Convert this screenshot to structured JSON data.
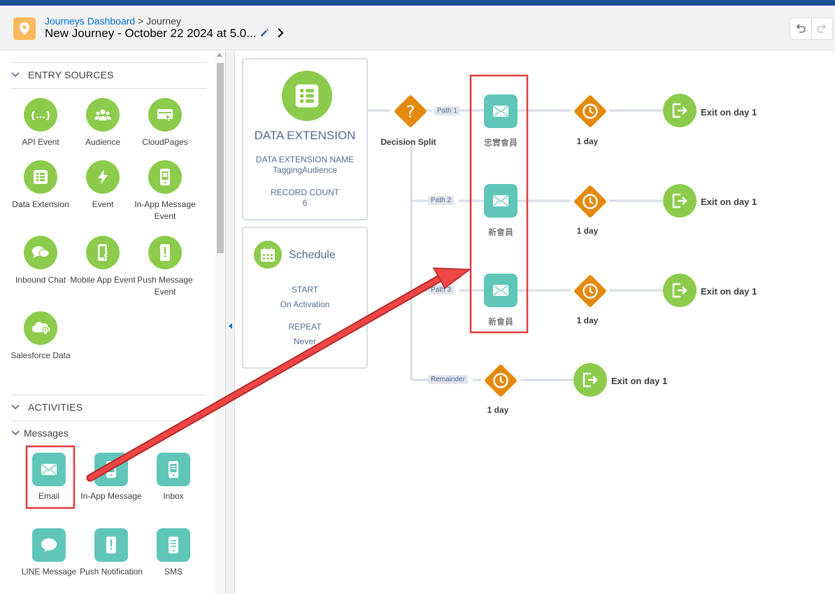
{
  "header": {
    "breadcrumb_link": "Journeys Dashboard",
    "breadcrumb_sep": ">",
    "breadcrumb_current": "Journey",
    "journey_title": "New Journey - October 22 2024 at 5.0..."
  },
  "palette": {
    "entry_sources": {
      "heading": "ENTRY SOURCES",
      "items": [
        {
          "label": "API Event",
          "icon": "api-icon"
        },
        {
          "label": "Audience",
          "icon": "audience-icon"
        },
        {
          "label": "CloudPages",
          "icon": "cloudpages-icon"
        },
        {
          "label": "Data Extension",
          "icon": "data-extension-icon"
        },
        {
          "label": "Event",
          "icon": "event-icon"
        },
        {
          "label": "In-App Message Event",
          "icon": "in-app-message-event-icon"
        },
        {
          "label": "Inbound Chat",
          "icon": "inbound-chat-icon"
        },
        {
          "label": "Mobile App Event",
          "icon": "mobile-app-event-icon"
        },
        {
          "label": "Push Message Event",
          "icon": "push-message-event-icon"
        },
        {
          "label": "Salesforce Data",
          "icon": "salesforce-data-icon"
        }
      ]
    },
    "activities": {
      "heading": "ACTIVITIES",
      "messages_heading": "Messages",
      "items": [
        {
          "label": "Email",
          "icon": "email-icon"
        },
        {
          "label": "In-App Message",
          "icon": "in-app-message-icon"
        },
        {
          "label": "Inbox",
          "icon": "inbox-icon"
        },
        {
          "label": "LINE Message",
          "icon": "line-message-icon"
        },
        {
          "label": "Push Notification",
          "icon": "push-notification-icon"
        },
        {
          "label": "SMS",
          "icon": "sms-icon"
        }
      ]
    }
  },
  "canvas": {
    "entry_card": {
      "title": "DATA EXTENSION",
      "name_label": "DATA EXTENSION NAME",
      "name_value": "TaggingAudience",
      "count_label": "RECORD COUNT",
      "count_value": "6"
    },
    "schedule_card": {
      "title": "Schedule",
      "start_label": "START",
      "start_value": "On Activation",
      "repeat_label": "REPEAT",
      "repeat_value": "Never"
    },
    "decision": {
      "label": "Decision Split"
    },
    "paths": [
      {
        "tag": "Path 1",
        "email_label": "忠實會員",
        "wait_label": "1 day",
        "exit_label": "Exit on day 1"
      },
      {
        "tag": "Path 2",
        "email_label": "新會員",
        "wait_label": "1 day",
        "exit_label": "Exit on day 1"
      },
      {
        "tag": "Path 3",
        "email_label": "新會員",
        "wait_label": "1 day",
        "exit_label": "Exit on day 1"
      },
      {
        "tag": "Remainder",
        "wait_label": "1 day",
        "exit_label": "Exit on day 1"
      }
    ]
  },
  "colors": {
    "entry_green": "#8ccb4c",
    "message_teal": "#5fc6b8",
    "flow_orange": "#e38a0f",
    "highlight_red": "#e03c3c",
    "link_blue": "#0070d2"
  }
}
